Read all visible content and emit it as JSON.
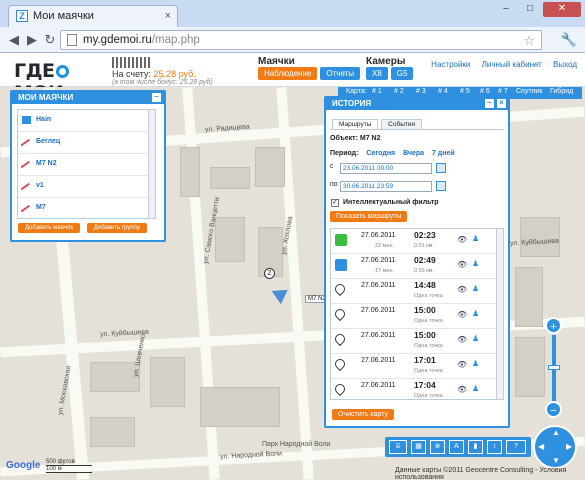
{
  "browser": {
    "tab_title": "Мои маячки",
    "tab_close": "×",
    "favicon": "Z",
    "url_host": "my.gdemoi.ru",
    "url_path": "/map.php",
    "window_buttons": [
      "–",
      "□",
      "✕"
    ]
  },
  "header": {
    "logo": "ГДЕМОИ",
    "account_name": "■■■■■■■",
    "balance_label": "На счету:",
    "balance_value": "25.28 руб.",
    "bonus_note": "(в том числе бонус: 25.28 руб)",
    "beacons_title": "Маячки",
    "beacons_btn_watch": "Наблюдение",
    "beacons_btn_reports": "Отчеты",
    "cameras_title": "Камеры",
    "camera_x8": "X8",
    "camera_g5": "G5",
    "links": [
      "Настройки",
      "Личный кабинет",
      "Выход"
    ]
  },
  "maptoolbar": {
    "label": "Карта:",
    "items": [
      "# 1",
      "# 2",
      "# 3",
      "# 4",
      "# 5",
      "# 6",
      "# 7",
      "Спутник",
      "Гибрид"
    ]
  },
  "beacons_panel": {
    "title": "МОИ МАЯЧКИ",
    "items": [
      {
        "name": "Hain",
        "icon": "blue-square-icon"
      },
      {
        "name": "Беглец",
        "icon": "offline-icon"
      },
      {
        "name": "M7 N2",
        "icon": "offline-icon"
      },
      {
        "name": "v1",
        "icon": "offline-icon"
      },
      {
        "name": "M7",
        "icon": "offline-icon"
      }
    ],
    "add_beacon": "Добавить маячок",
    "add_group": "Добавить группу"
  },
  "history_panel": {
    "title": "ИСТОРИЯ",
    "tabs": [
      "Маршруты",
      "События"
    ],
    "object_label": "Объект: М7 N2",
    "period_label": "Период:",
    "period_links": [
      "Сегодня",
      "Вчера",
      "7 дней"
    ],
    "from_label": "с",
    "from_value": "23.06.2011 00:00",
    "to_label": "по",
    "to_value": "30.06.2011 23:59",
    "filter_label": "Интеллектуальный фильтр",
    "show_routes": "Показать маршруты",
    "points": [
      {
        "icon": "green",
        "date": "27.06.2011",
        "sub": "22 мин.",
        "time": "02:23",
        "sub2": "0.91 км."
      },
      {
        "icon": "blue",
        "date": "27.06.2011",
        "sub": "17 мин.",
        "time": "02:49",
        "sub2": "0.55 км."
      },
      {
        "icon": "pin",
        "num": "2",
        "date": "27.06.2011",
        "sub": "",
        "time": "14:48",
        "sub2": "Одна точка"
      },
      {
        "icon": "pin",
        "num": "3",
        "date": "27.06.2011",
        "sub": "",
        "time": "15:00",
        "sub2": "Одна точка"
      },
      {
        "icon": "pin",
        "num": "4",
        "date": "27.06.2011",
        "sub": "",
        "time": "15:00",
        "sub2": "Одна точка"
      },
      {
        "icon": "pin",
        "num": "5",
        "date": "27.06.2011",
        "sub": "",
        "time": "17:01",
        "sub2": "Одна точка"
      },
      {
        "icon": "pin",
        "num": "6",
        "date": "27.06.2011",
        "sub": "",
        "time": "17:04",
        "sub2": "Одна точка"
      }
    ],
    "clear_map": "Очистить карту"
  },
  "map": {
    "streets": [
      "ул. Радищева",
      "ул. Куйбышева",
      "ул. Садовая",
      "ул. Самого Ванцетти",
      "ул. Хохлова",
      "ул. Московская",
      "ул. Шевченко",
      "ул. Народной Воли",
      "Парк Народной Воли"
    ],
    "route_label": "М7 N2",
    "marker_label": "2",
    "copyright": "Данные карты ©2011 Geocentre Consulting - Условия использования",
    "google": "Google",
    "scale_top": "500 футов",
    "scale_bottom": "100 м"
  }
}
